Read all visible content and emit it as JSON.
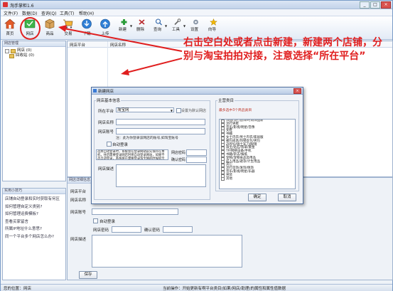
{
  "window": {
    "title": "淘手掌柜1.6",
    "minimize": "_",
    "maximize": "□",
    "close": "×"
  },
  "menu": [
    "文件(F)",
    "数据(D)",
    "查询(Q)",
    "工具(T)",
    "帮助(H)"
  ],
  "toolbar": {
    "home": "首页",
    "shop": "网店",
    "goods": "商品",
    "trade": "交易",
    "download": "下载",
    "upload": "上传",
    "new": "新建",
    "delete": "删除",
    "query": "查询",
    "tools": "工具",
    "settings": "设置",
    "wizard": "向导"
  },
  "left_panel": {
    "header": "网店管理",
    "tree": [
      {
        "label": "网店 (0)",
        "level": 0
      },
      {
        "label": "回收站 (0)",
        "level": 1
      }
    ]
  },
  "help_panel": {
    "header": "实用小技巧",
    "items": [
      "店铺自动登录和实时获取有何区",
      "如何管理自定义类别?",
      "如何管理运费模板?",
      "查看买家留言",
      "所属IP地址什么意思?",
      "同一个平台多个网店怎么办?"
    ]
  },
  "grid": {
    "columns": [
      "网店平台",
      "网店名称"
    ]
  },
  "bottom_form": {
    "header": "网店详细信息",
    "platform_label": "网店平台",
    "name_label": "网店名称",
    "account_label": "网店账号",
    "auto_login_label": "自动登录",
    "password_label": "网店密码",
    "confirm_password_label": "确认密码",
    "desc_label": "网店描述",
    "save_button": "保存"
  },
  "dialog": {
    "title": "新建网店",
    "close": "×",
    "basic_group": "网店基本信息",
    "platform_label": "所在平台",
    "platform_value": "淘宝网",
    "default_check_label": "设置为默认网店",
    "name_label": "网店名称",
    "account_label": "网店账号",
    "account_note": "注：此为你登录该网店的账号,如淘宝账号",
    "auto_login_label": "自动登录",
    "tip_text": "选择自动登录时，系统会在登录网站前先保存在本机，往后需要登录网店时将自动登录网站，如果不选自动登录，系统将在需要登录淘宝网的时候提示手动登录",
    "password_label": "网店密码",
    "confirm_label": "确认密码",
    "desc_label": "网店描述",
    "category_group": "主营类目",
    "category_note": "最多选中3个商品类目",
    "categories": [
      "饰品/流行首饰/时尚饰品新",
      "流行男鞋",
      "音乐/影视/明星/音像",
      "女鞋",
      "书籍",
      "女士内衣/男士内衣/家居服",
      "箱包皮具/热销女包/男包",
      "ZIPPO/瑞士军刀/眼镜",
      "珠宝/钻石/翡翠/黄金",
      "TP/网络设备/手机",
      "书籍/杂志/报纸",
      "宠物/宠物食品及用品",
      "成人用品/避孕/计生用品",
      "其它",
      "流行首饰/发饰/佩饰",
      "音乐/影视/明星/乐器",
      "男装",
      "其他"
    ],
    "ok_button": "确定",
    "cancel_button": "取消"
  },
  "statusbar": {
    "position_label": "您的位置：",
    "position_value": "网店",
    "tip": "当前操作：开始更新有啊平台类目(如果/网店/助理)的属性和属性值数据"
  },
  "annotation": "右击空白处或者点击新建，新建两个店铺，分别与淘宝拍拍对接，注意选择“所在平台”"
}
